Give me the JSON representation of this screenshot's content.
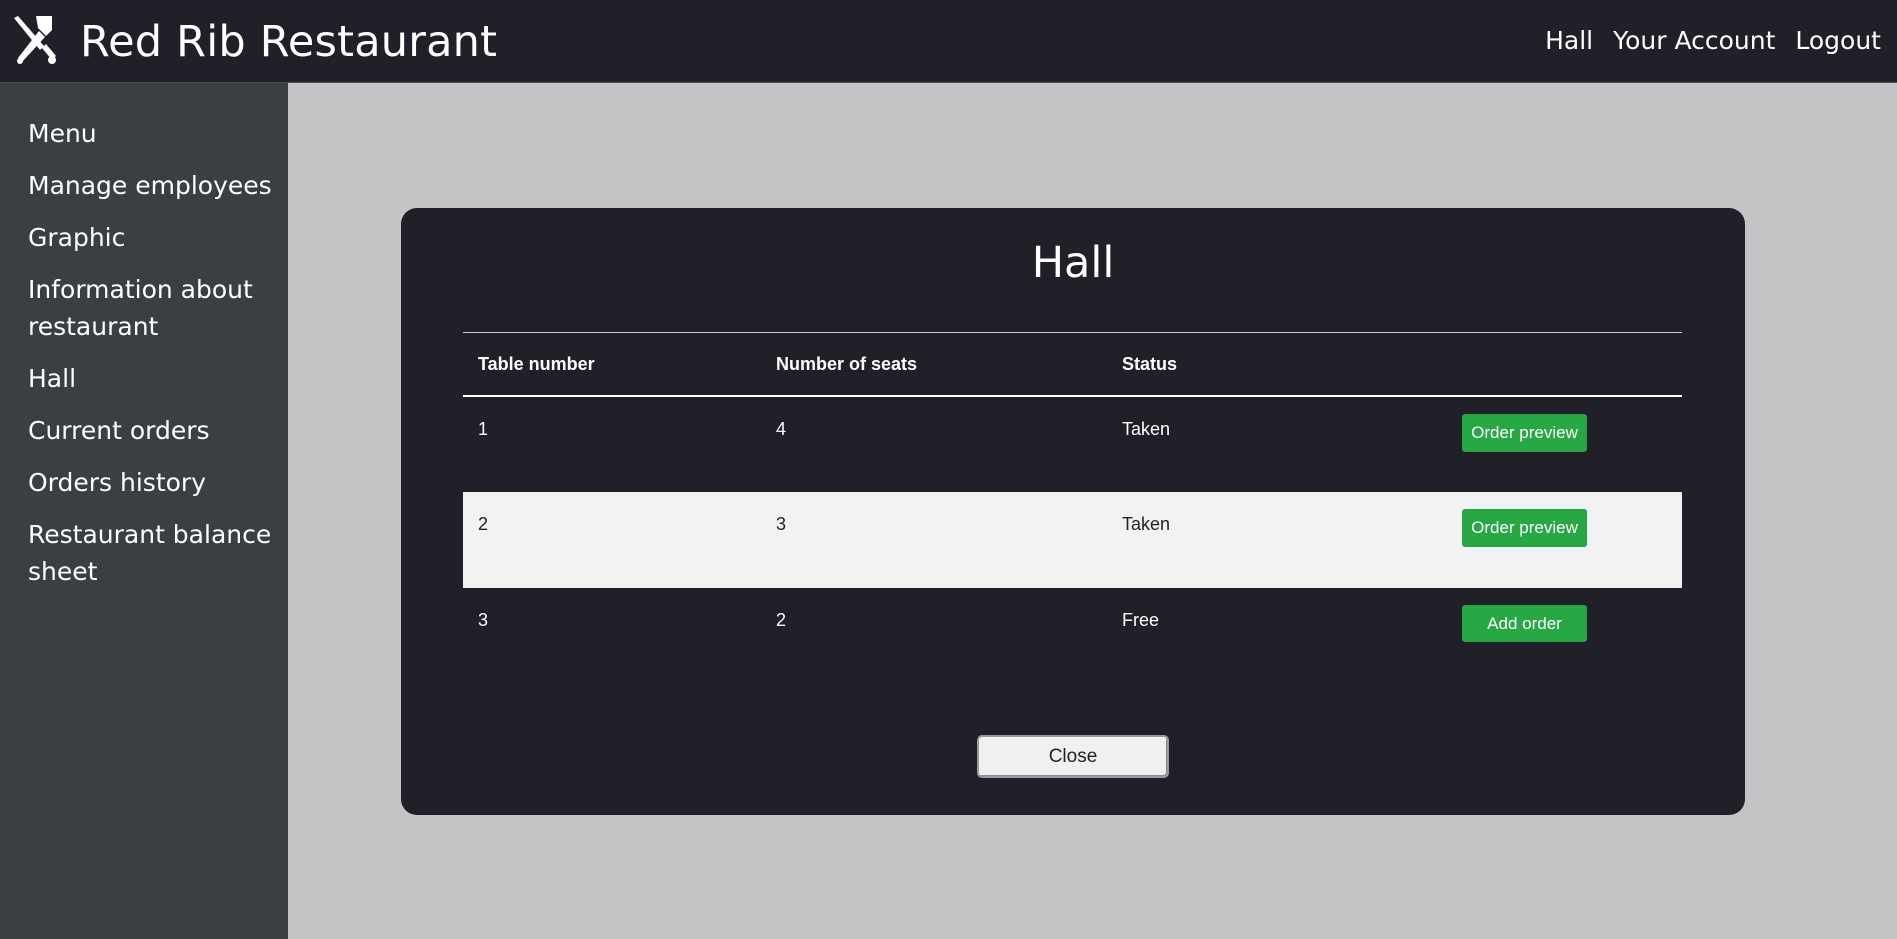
{
  "header": {
    "brand_title": "Red Rib Restaurant",
    "brand_icon": "crossed-cleaver-knife-icon",
    "nav": [
      "Hall",
      "Your Account",
      "Logout"
    ]
  },
  "sidebar": {
    "items": [
      {
        "label": "Menu"
      },
      {
        "label": "Manage employees"
      },
      {
        "label": "Graphic"
      },
      {
        "label": "Information about restaurant"
      },
      {
        "label": "Hall"
      },
      {
        "label": "Current orders"
      },
      {
        "label": "Orders history"
      },
      {
        "label": "Restaurant balance sheet"
      }
    ]
  },
  "modal": {
    "title": "Hall",
    "columns": [
      "Table number",
      "Number of seats",
      "Status",
      ""
    ],
    "rows": [
      {
        "table": "1",
        "seats": "4",
        "status": "Taken",
        "action": "Order preview"
      },
      {
        "table": "2",
        "seats": "3",
        "status": "Taken",
        "action": "Order preview"
      },
      {
        "table": "3",
        "seats": "2",
        "status": "Free",
        "action": "Add order"
      }
    ],
    "close_label": "Close"
  },
  "colors": {
    "topbar": "#1f2028",
    "sidebar": "#393f43",
    "page_background": "#c3c4c6",
    "modal": "#1f2028",
    "action_button": "#28a745"
  }
}
